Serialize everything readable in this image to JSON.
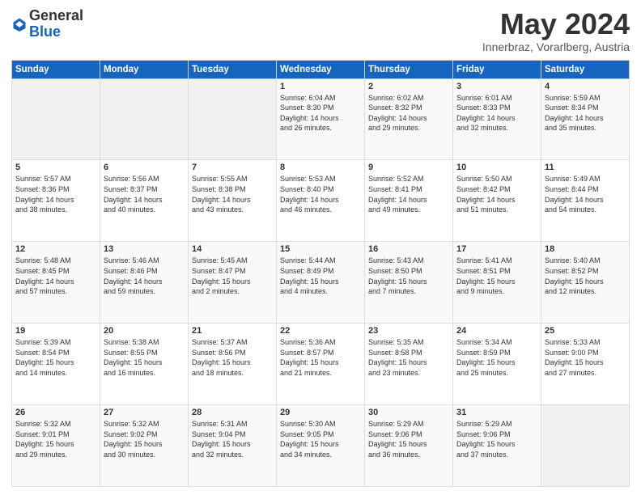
{
  "header": {
    "logo_general": "General",
    "logo_blue": "Blue",
    "month": "May 2024",
    "location": "Innerbraz, Vorarlberg, Austria"
  },
  "days_of_week": [
    "Sunday",
    "Monday",
    "Tuesday",
    "Wednesday",
    "Thursday",
    "Friday",
    "Saturday"
  ],
  "weeks": [
    [
      {
        "day": "",
        "info": ""
      },
      {
        "day": "",
        "info": ""
      },
      {
        "day": "",
        "info": ""
      },
      {
        "day": "1",
        "info": "Sunrise: 6:04 AM\nSunset: 8:30 PM\nDaylight: 14 hours\nand 26 minutes."
      },
      {
        "day": "2",
        "info": "Sunrise: 6:02 AM\nSunset: 8:32 PM\nDaylight: 14 hours\nand 29 minutes."
      },
      {
        "day": "3",
        "info": "Sunrise: 6:01 AM\nSunset: 8:33 PM\nDaylight: 14 hours\nand 32 minutes."
      },
      {
        "day": "4",
        "info": "Sunrise: 5:59 AM\nSunset: 8:34 PM\nDaylight: 14 hours\nand 35 minutes."
      }
    ],
    [
      {
        "day": "5",
        "info": "Sunrise: 5:57 AM\nSunset: 8:36 PM\nDaylight: 14 hours\nand 38 minutes."
      },
      {
        "day": "6",
        "info": "Sunrise: 5:56 AM\nSunset: 8:37 PM\nDaylight: 14 hours\nand 40 minutes."
      },
      {
        "day": "7",
        "info": "Sunrise: 5:55 AM\nSunset: 8:38 PM\nDaylight: 14 hours\nand 43 minutes."
      },
      {
        "day": "8",
        "info": "Sunrise: 5:53 AM\nSunset: 8:40 PM\nDaylight: 14 hours\nand 46 minutes."
      },
      {
        "day": "9",
        "info": "Sunrise: 5:52 AM\nSunset: 8:41 PM\nDaylight: 14 hours\nand 49 minutes."
      },
      {
        "day": "10",
        "info": "Sunrise: 5:50 AM\nSunset: 8:42 PM\nDaylight: 14 hours\nand 51 minutes."
      },
      {
        "day": "11",
        "info": "Sunrise: 5:49 AM\nSunset: 8:44 PM\nDaylight: 14 hours\nand 54 minutes."
      }
    ],
    [
      {
        "day": "12",
        "info": "Sunrise: 5:48 AM\nSunset: 8:45 PM\nDaylight: 14 hours\nand 57 minutes."
      },
      {
        "day": "13",
        "info": "Sunrise: 5:46 AM\nSunset: 8:46 PM\nDaylight: 14 hours\nand 59 minutes."
      },
      {
        "day": "14",
        "info": "Sunrise: 5:45 AM\nSunset: 8:47 PM\nDaylight: 15 hours\nand 2 minutes."
      },
      {
        "day": "15",
        "info": "Sunrise: 5:44 AM\nSunset: 8:49 PM\nDaylight: 15 hours\nand 4 minutes."
      },
      {
        "day": "16",
        "info": "Sunrise: 5:43 AM\nSunset: 8:50 PM\nDaylight: 15 hours\nand 7 minutes."
      },
      {
        "day": "17",
        "info": "Sunrise: 5:41 AM\nSunset: 8:51 PM\nDaylight: 15 hours\nand 9 minutes."
      },
      {
        "day": "18",
        "info": "Sunrise: 5:40 AM\nSunset: 8:52 PM\nDaylight: 15 hours\nand 12 minutes."
      }
    ],
    [
      {
        "day": "19",
        "info": "Sunrise: 5:39 AM\nSunset: 8:54 PM\nDaylight: 15 hours\nand 14 minutes."
      },
      {
        "day": "20",
        "info": "Sunrise: 5:38 AM\nSunset: 8:55 PM\nDaylight: 15 hours\nand 16 minutes."
      },
      {
        "day": "21",
        "info": "Sunrise: 5:37 AM\nSunset: 8:56 PM\nDaylight: 15 hours\nand 18 minutes."
      },
      {
        "day": "22",
        "info": "Sunrise: 5:36 AM\nSunset: 8:57 PM\nDaylight: 15 hours\nand 21 minutes."
      },
      {
        "day": "23",
        "info": "Sunrise: 5:35 AM\nSunset: 8:58 PM\nDaylight: 15 hours\nand 23 minutes."
      },
      {
        "day": "24",
        "info": "Sunrise: 5:34 AM\nSunset: 8:59 PM\nDaylight: 15 hours\nand 25 minutes."
      },
      {
        "day": "25",
        "info": "Sunrise: 5:33 AM\nSunset: 9:00 PM\nDaylight: 15 hours\nand 27 minutes."
      }
    ],
    [
      {
        "day": "26",
        "info": "Sunrise: 5:32 AM\nSunset: 9:01 PM\nDaylight: 15 hours\nand 29 minutes."
      },
      {
        "day": "27",
        "info": "Sunrise: 5:32 AM\nSunset: 9:02 PM\nDaylight: 15 hours\nand 30 minutes."
      },
      {
        "day": "28",
        "info": "Sunrise: 5:31 AM\nSunset: 9:04 PM\nDaylight: 15 hours\nand 32 minutes."
      },
      {
        "day": "29",
        "info": "Sunrise: 5:30 AM\nSunset: 9:05 PM\nDaylight: 15 hours\nand 34 minutes."
      },
      {
        "day": "30",
        "info": "Sunrise: 5:29 AM\nSunset: 9:06 PM\nDaylight: 15 hours\nand 36 minutes."
      },
      {
        "day": "31",
        "info": "Sunrise: 5:29 AM\nSunset: 9:06 PM\nDaylight: 15 hours\nand 37 minutes."
      },
      {
        "day": "",
        "info": ""
      }
    ]
  ]
}
